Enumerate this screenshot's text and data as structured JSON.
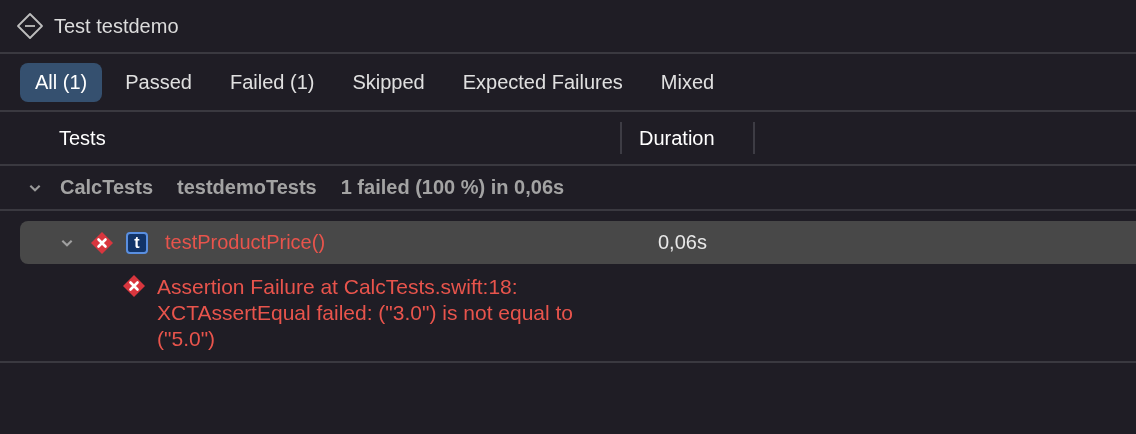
{
  "window": {
    "title": "Test testdemo"
  },
  "tabs": [
    {
      "label": "All (1)",
      "selected": true
    },
    {
      "label": "Passed",
      "selected": false
    },
    {
      "label": "Failed (1)",
      "selected": false
    },
    {
      "label": "Skipped",
      "selected": false
    },
    {
      "label": "Expected Failures",
      "selected": false
    },
    {
      "label": "Mixed",
      "selected": false
    }
  ],
  "table": {
    "columns": [
      "Tests",
      "Duration"
    ],
    "group": {
      "name": "CalcTests",
      "target": "testdemoTests",
      "summary": "1 failed (100 %) in 0,06s",
      "expanded": true,
      "tests": [
        {
          "type_badge": "t",
          "name": "testProductPrice()",
          "duration": "0,06s",
          "failed": true,
          "expanded": true,
          "selected": true,
          "issues": [
            {
              "failed": true,
              "message": "Assertion Failure at CalcTests.swift:18: XCTAssertEqual failed: (\"3.0\") is not equal to (\"5.0\")"
            }
          ]
        }
      ]
    }
  }
}
